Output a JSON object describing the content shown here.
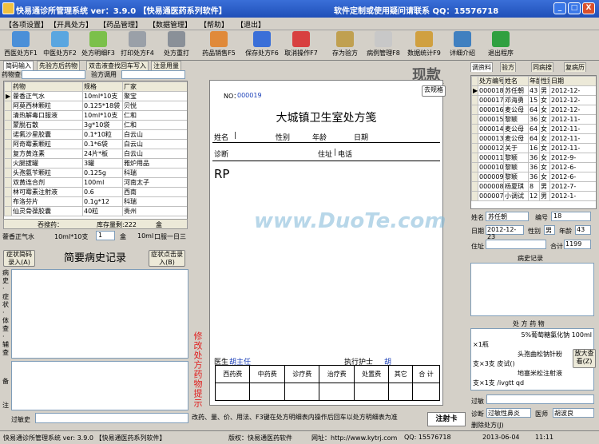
{
  "titlebar": {
    "title": "快易通诊所管理系统  ver：3.9.0  【快易通医药系列软件】",
    "contact": "软件定制或使用疑问请联系 QQ：15576718",
    "min": "_",
    "max": "□",
    "close": "X"
  },
  "menu": [
    "【各项设置】",
    "【开具处方】",
    "【药品管理】",
    "【数据管理】",
    "【帮助】",
    "【退出】"
  ],
  "toolbar": [
    "西医处方F1",
    "中医处方F2",
    "处方明细F3",
    "打印处方F4",
    "处方重打",
    "药品销售F5",
    "保存处方F6",
    "取消操作F7",
    "存为验方",
    "病例管理F8",
    "数据统计F9",
    "详细介绍",
    "退出程序"
  ],
  "left": {
    "tabs": [
      "简码输入",
      "先验方后药物",
      "双击液查找回车写入",
      "注意用量"
    ],
    "search_label": "药物查找",
    "search2_label": "验方调用",
    "columns": [
      "药物",
      "规格",
      "厂家"
    ],
    "rows": [
      [
        "藿香正气水",
        "10ml*10支",
        "聚宝"
      ],
      [
        "阿莫西林颗粒",
        "0.125*18袋",
        "贝悦"
      ],
      [
        "清热解毒口服液",
        "10ml*10支",
        "仁和"
      ],
      [
        "蒙脱石散",
        "3g*10袋",
        "仁和"
      ],
      [
        "诺氟沙星胶囊",
        "0.1*10粒",
        "白云山"
      ],
      [
        "阿奇霉素颗粒",
        "0.1*6袋",
        "白云山"
      ],
      [
        "复方黄连素",
        "24片*板",
        "白云山"
      ],
      [
        "火腿拔罐",
        "3罐",
        "雅炉用品"
      ],
      [
        "头孢氨苄颗粒",
        "0.125g",
        "科瑞"
      ],
      [
        "双黄连合剂",
        "100ml",
        "河南太子"
      ],
      [
        "林可霉素注射液",
        "0.6",
        "西南"
      ],
      [
        "布洛芬片",
        "0.1g*12",
        "科瑞"
      ],
      [
        "仙灵骨葆胶囊",
        "40粒",
        "贵州"
      ]
    ],
    "footer_label": "吞搜药：",
    "stock_label": "库存量剩:222",
    "stock_unit": "盒",
    "cur_drug": "藿香正气水",
    "cur_spec": "10ml*10支",
    "cur_qty": "1",
    "cur_unit": "盒",
    "cur_spec2": "10ml",
    "cur_usage": "口服一日三",
    "btn_left": "症状简码录入(A)",
    "btn_right": "症状点击录入(B)",
    "history_title": "简要病史记录",
    "side_labels": [
      "病史",
      "症状",
      "体查",
      "辅查"
    ],
    "bottom_labels": [
      "备",
      "注"
    ],
    "allergy_label": "过敏史"
  },
  "presc": {
    "no_label": "NO：",
    "no": "000019",
    "title": "大城镇卫生室处方笺",
    "btn": "去规格",
    "fields": [
      "姓名",
      "性别",
      "年龄",
      "日期",
      "诊断",
      "住址",
      "电话"
    ],
    "rp": "RP",
    "doctor_label": "医生",
    "doctor": "胡主任",
    "nurse_label": "执行护士",
    "nurse": "胡",
    "fees": [
      "西药费",
      "中药费",
      "诊疗费",
      "治疗费",
      "处置费",
      "其它",
      "合 计"
    ]
  },
  "center": {
    "header": "现款",
    "hint": "修改处方药物提示",
    "note": "改药、量、价、用法、F3键在处方明细表内操作后回车以处方明细表为准",
    "button": "注射卡",
    "scroll_top": "高"
  },
  "right": {
    "tabs": [
      "调资料",
      "验方",
      "同病搜",
      "复病历"
    ],
    "columns": [
      "处方编号",
      "姓名",
      "年龄",
      "性别",
      "日期"
    ],
    "rows": [
      [
        "000018",
        "苏任朝",
        "43",
        "男",
        "2012-12-"
      ],
      [
        "000017",
        "邓海勇",
        "15",
        "女",
        "2012-12-"
      ],
      [
        "000016",
        "麦公母",
        "64",
        "女",
        "2012-12-"
      ],
      [
        "000015",
        "黎颖",
        "36",
        "女",
        "2012-11-"
      ],
      [
        "000014",
        "麦公母",
        "64",
        "女",
        "2012-11-"
      ],
      [
        "000013",
        "麦公母",
        "64",
        "女",
        "2012-11-"
      ],
      [
        "000012",
        "关于",
        "16",
        "女",
        "2012-11-"
      ],
      [
        "000011",
        "黎颖",
        "36",
        "女",
        "2012-9-"
      ],
      [
        "000010",
        "黎颖",
        "36",
        "女",
        "2012-6-"
      ],
      [
        "000009",
        "黎颖",
        "36",
        "女",
        "2012-6-"
      ],
      [
        "000008",
        "杨夏琪",
        "8",
        "男",
        "2012-7-"
      ],
      [
        "000007",
        "小调试",
        "12",
        "男",
        "2012-1-"
      ]
    ],
    "name_label": "姓名",
    "name": "苏任朝",
    "no_label": "编号",
    "no": "18",
    "date_label": "日期",
    "date": "2012-12-23",
    "sex_label": "性别",
    "sex": "男",
    "age_label": "年龄",
    "age": "43",
    "addr_label": "住址",
    "total_label": "合计",
    "total": "1199",
    "history_label": "病史记录",
    "drugs_label": "处 方 药 物",
    "drug_lines": [
      "5%葡萄糖氯化钠  100ml",
      "×1瓶",
      "头孢曲松钠针粉",
      "支×3支 皮试()",
      "地塞米松注射液",
      "支×1支 /ivgtt qd"
    ],
    "zoom_btn": "放大查看(Z)",
    "allergy_label": "过敏",
    "diag_label": "诊断",
    "diag": "过敏性鼻炎",
    "doc_label": "医师",
    "doc": "胡波良",
    "delete_label": "删除处方(J)"
  },
  "statusbar": {
    "a": "快易通诊所管理系统   ver: 3.9.0   【快易通医药系列软件】",
    "b": "版权：快易通医药软件",
    "c": "网址：http://www.kytrj.com",
    "d": "QQ: 15576718",
    "e": "2013-06-04",
    "f": "11:11"
  },
  "watermark": "www.DuoTe.com",
  "colors": {
    "title": "#1f4fb8",
    "accent_red": "#e02020"
  }
}
